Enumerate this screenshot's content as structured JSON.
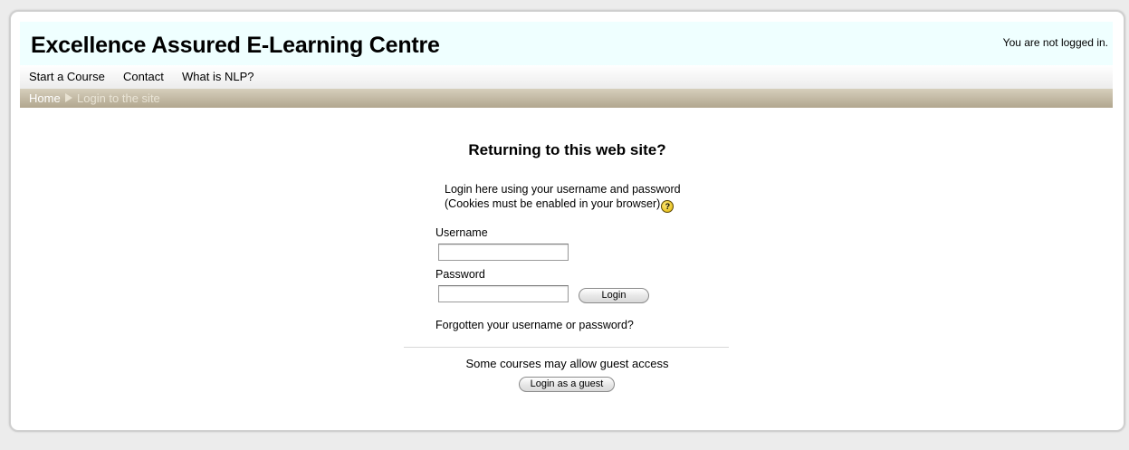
{
  "header": {
    "site_title": "Excellence Assured E-Learning Centre",
    "login_status": "You are not logged in."
  },
  "menu": {
    "items": [
      {
        "label": "Start a Course"
      },
      {
        "label": "Contact"
      },
      {
        "label": "What is NLP?"
      }
    ]
  },
  "breadcrumb": {
    "home": "Home",
    "current": "Login to the site"
  },
  "login": {
    "heading": "Returning to this web site?",
    "instructions_line1": "Login here using your username and password",
    "instructions_line2": "(Cookies must be enabled in your browser)",
    "help_icon_glyph": "?",
    "username_label": "Username",
    "username_value": "",
    "password_label": "Password",
    "password_value": "",
    "login_button": "Login",
    "forgot_link": "Forgotten your username or password?"
  },
  "guest": {
    "text": "Some courses may allow guest access",
    "button": "Login as a guest"
  },
  "colors": {
    "header_bg": "#efffff",
    "navbar_bg": "#b1a68e",
    "page_bg": "#ececec",
    "help_icon": "#e0b400"
  },
  "icons": {
    "help": "help-question-icon",
    "breadcrumb_separator": "breadcrumb-arrow-icon"
  }
}
